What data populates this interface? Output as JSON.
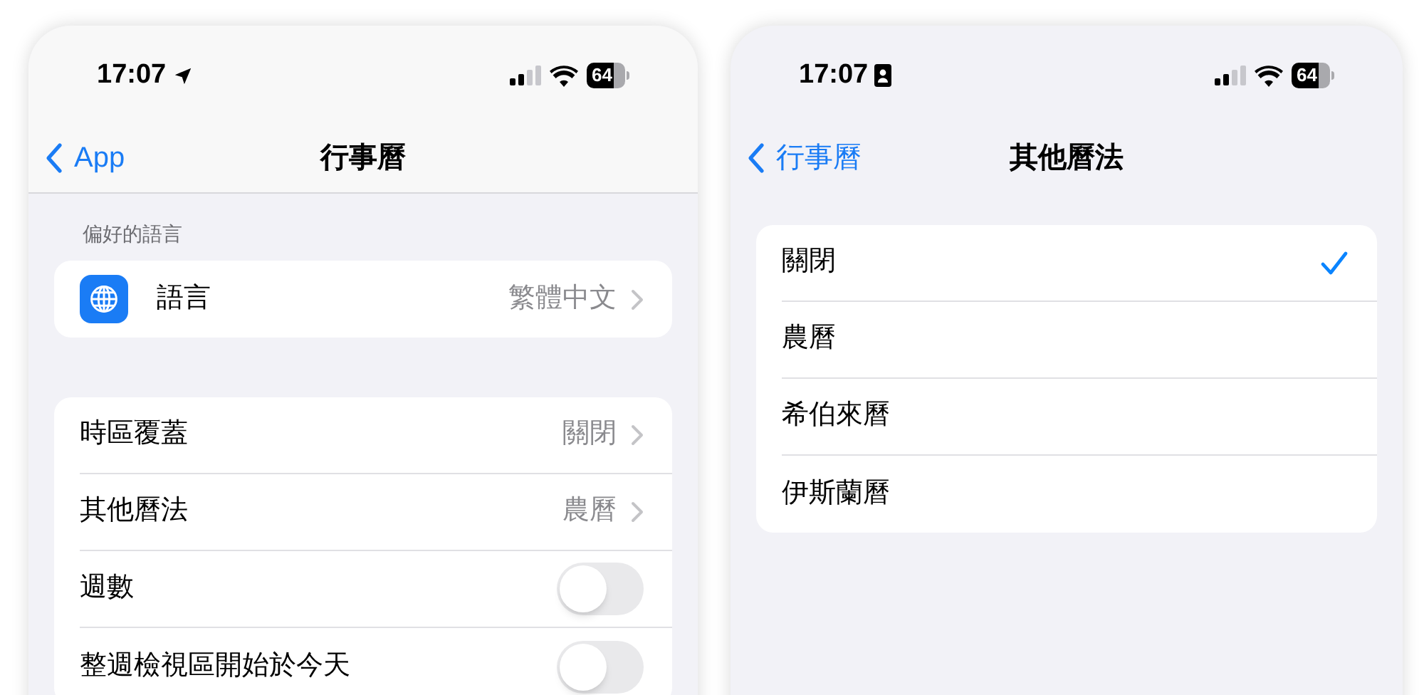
{
  "phones": [
    {
      "status": {
        "time": "17:07",
        "battery": "64"
      },
      "nav": {
        "back": "App",
        "title": "行事曆"
      },
      "sections": [
        {
          "header": "偏好的語言",
          "rows": [
            {
              "kind": "app_link",
              "label": "語言",
              "value": "繁體中文"
            }
          ]
        },
        {
          "rows": [
            {
              "kind": "link",
              "label": "時區覆蓋",
              "value": "關閉"
            },
            {
              "kind": "link",
              "label": "其他曆法",
              "value": "農曆"
            },
            {
              "kind": "toggle",
              "label": "週數",
              "on": false
            },
            {
              "kind": "toggle",
              "label": "整週檢視區開始於今天",
              "on": false
            }
          ]
        }
      ]
    },
    {
      "status": {
        "time": "17:07",
        "battery": "64"
      },
      "nav": {
        "back": "行事曆",
        "title": "其他曆法"
      },
      "sections": [
        {
          "rows": [
            {
              "kind": "choice",
              "label": "關閉",
              "selected": true
            },
            {
              "kind": "choice",
              "label": "農曆",
              "selected": false
            },
            {
              "kind": "choice",
              "label": "希伯來曆",
              "selected": false
            },
            {
              "kind": "choice",
              "label": "伊斯蘭曆",
              "selected": false
            }
          ]
        }
      ]
    }
  ]
}
